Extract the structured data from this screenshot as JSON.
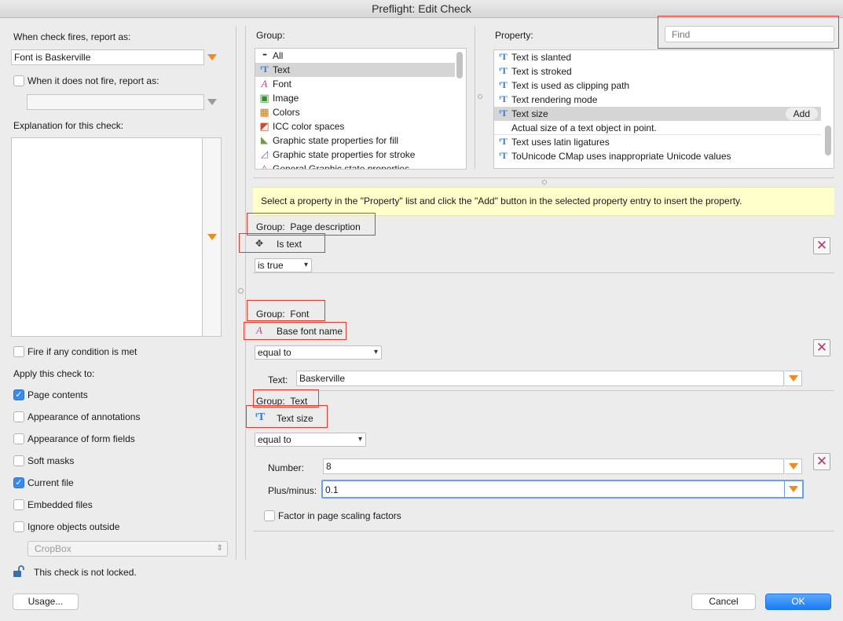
{
  "window": {
    "title": "Preflight: Edit Check"
  },
  "left": {
    "report_label": "When check fires, report as:",
    "report_value": "Font is Baskerville",
    "not_fire_label": "When it does not fire, report as:",
    "not_fire_value": "",
    "explanation_label": "Explanation for this check:",
    "fire_any_label": "Fire if any condition is met",
    "apply_label": "Apply this check to:",
    "apply_items": [
      {
        "label": "Page contents",
        "checked": true
      },
      {
        "label": "Appearance of annotations",
        "checked": false
      },
      {
        "label": "Appearance of form fields",
        "checked": false
      },
      {
        "label": "Soft masks",
        "checked": false
      },
      {
        "label": "Current file",
        "checked": true
      },
      {
        "label": "Embedded files",
        "checked": false
      },
      {
        "label": "Ignore objects outside",
        "checked": false
      }
    ],
    "cropbox_value": "CropBox",
    "lock_text": "This check is not locked."
  },
  "group_panel": {
    "label": "Group:",
    "items": [
      {
        "label": "All",
        "icon": "dots-icon"
      },
      {
        "label": "Text",
        "icon": "text-icon"
      },
      {
        "label": "Font",
        "icon": "font-icon"
      },
      {
        "label": "Image",
        "icon": "image-icon"
      },
      {
        "label": "Colors",
        "icon": "colors-icon"
      },
      {
        "label": "ICC color spaces",
        "icon": "icc-icon"
      },
      {
        "label": "Graphic state properties for fill",
        "icon": "fill-icon"
      },
      {
        "label": "Graphic state properties for stroke",
        "icon": "stroke-icon"
      },
      {
        "label": "General Graphic state properties",
        "icon": "graphic-state-icon"
      }
    ]
  },
  "property_panel": {
    "label": "Property:",
    "find_placeholder": "Find",
    "items": [
      {
        "label": "Text is slanted"
      },
      {
        "label": "Text is stroked"
      },
      {
        "label": "Text is used as clipping path"
      },
      {
        "label": "Text rendering mode"
      },
      {
        "label": "Text size",
        "add_label": "Add",
        "description": "Actual size of a text object in point."
      },
      {
        "label": "Text uses latin ligatures"
      },
      {
        "label": "ToUnicode CMap uses inappropriate Unicode values"
      }
    ]
  },
  "hint": "Select a property in the \"Property\" list and click the \"Add\" button in the selected property entry to insert the property.",
  "conditions": [
    {
      "group_label": "Group:",
      "group_name": "Page description",
      "property": "Is text",
      "operator": "is true"
    },
    {
      "group_label": "Group:",
      "group_name": "Font",
      "property": "Base font name",
      "operator": "equal to",
      "field_label": "Text:",
      "field_value": "Baskerville"
    },
    {
      "group_label": "Group:",
      "group_name": "Text",
      "property": "Text size",
      "operator": "equal to",
      "number_label": "Number:",
      "number_value": "8",
      "plusminus_label": "Plus/minus:",
      "plusminus_value": "0.1",
      "factor_label": "Factor in page scaling factors"
    }
  ],
  "footer": {
    "usage_label": "Usage...",
    "cancel_label": "Cancel",
    "ok_label": "OK"
  },
  "colors": {
    "accent": "#1a7cf5",
    "highlight_red": "#e03c31",
    "orange": "#f08a1c",
    "hint_bg": "#ffffcc"
  }
}
